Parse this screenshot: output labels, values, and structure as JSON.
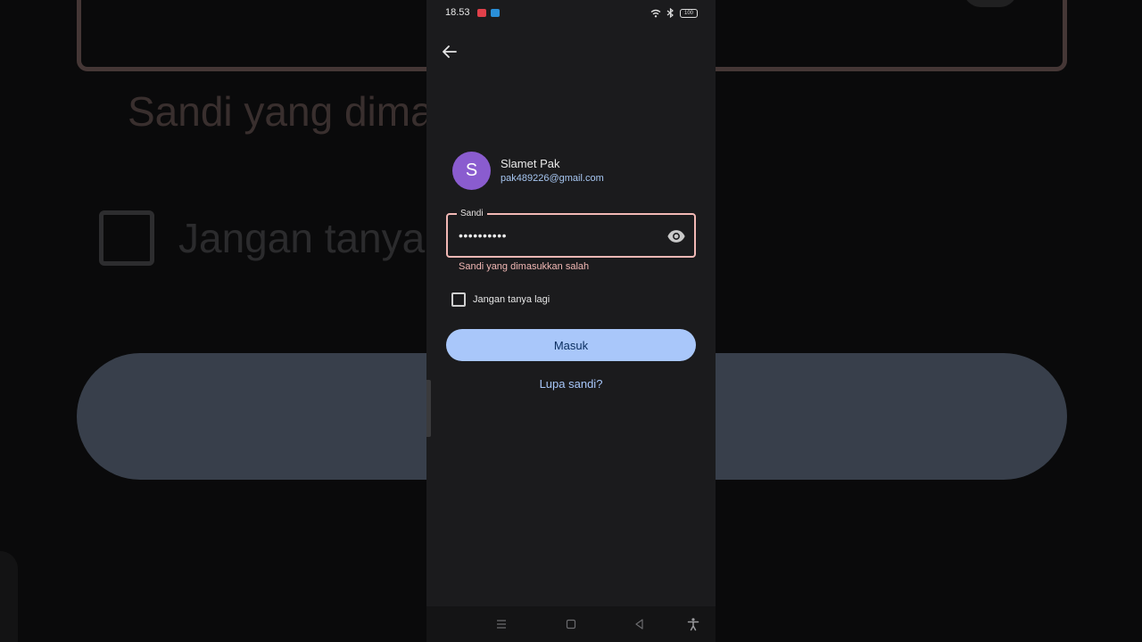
{
  "status_bar": {
    "time": "18.53",
    "battery": "100"
  },
  "account": {
    "avatar_letter": "S",
    "name": "Slamet Pak",
    "email": "pak489226@gmail.com"
  },
  "password_field": {
    "label": "Sandi",
    "value": "••••••••••"
  },
  "error_message": "Sandi yang dimasukkan salah",
  "remember": {
    "label": "Jangan tanya lagi",
    "checked": false
  },
  "primary_button": "Masuk",
  "forgot_link": "Lupa sandi?",
  "background": {
    "error_text": "Sandi yang dima",
    "checkbox_text": "Jangan tanya"
  },
  "colors": {
    "error": "#f2b8b5",
    "accent": "#a8c7fa",
    "avatar": "#8a5ccf"
  },
  "icons": [
    "back-arrow-icon",
    "eye-icon",
    "wifi-icon",
    "bluetooth-icon",
    "battery-icon",
    "menu-icon",
    "home-icon",
    "back-triangle-icon",
    "accessibility-icon"
  ]
}
